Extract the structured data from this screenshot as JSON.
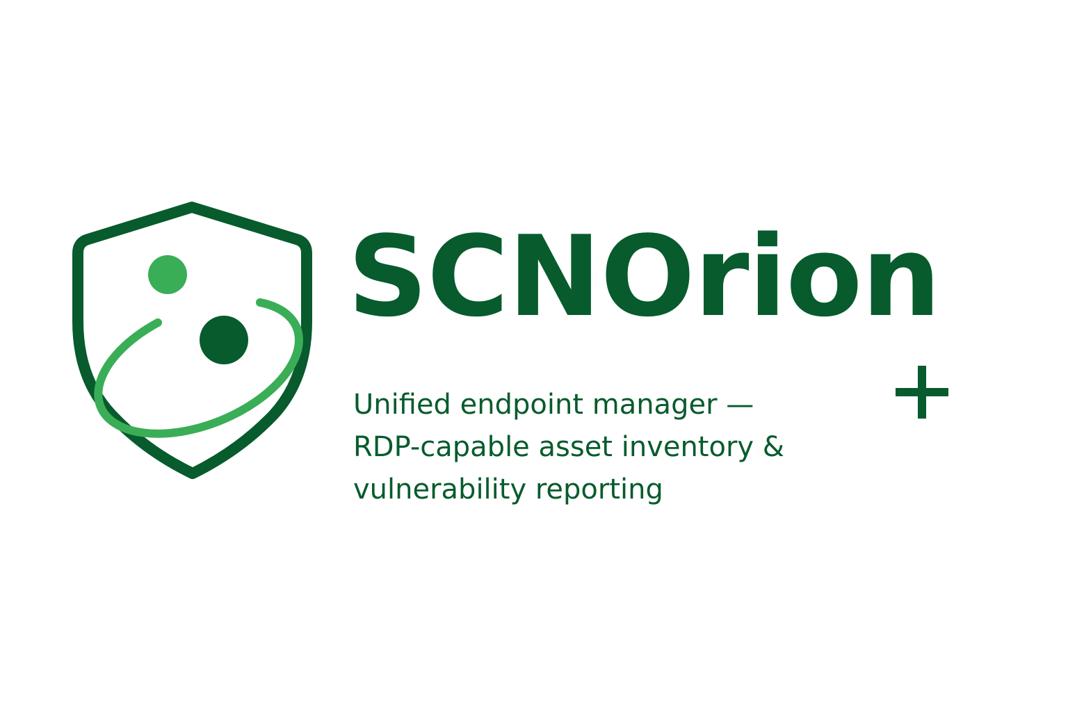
{
  "logo": {
    "icon": "shield-orbit-icon",
    "brand_name": "SCNOrion",
    "accent_icon": "plus-icon"
  },
  "tagline": {
    "lines": [
      "Unified endpoint manager —",
      "RDP-capable asset inventory &",
      "vulnerability reporting"
    ]
  },
  "colors": {
    "background": "#ffffff",
    "primary_dark_green": "#075b2c",
    "accent_light_green": "#3aad57"
  }
}
